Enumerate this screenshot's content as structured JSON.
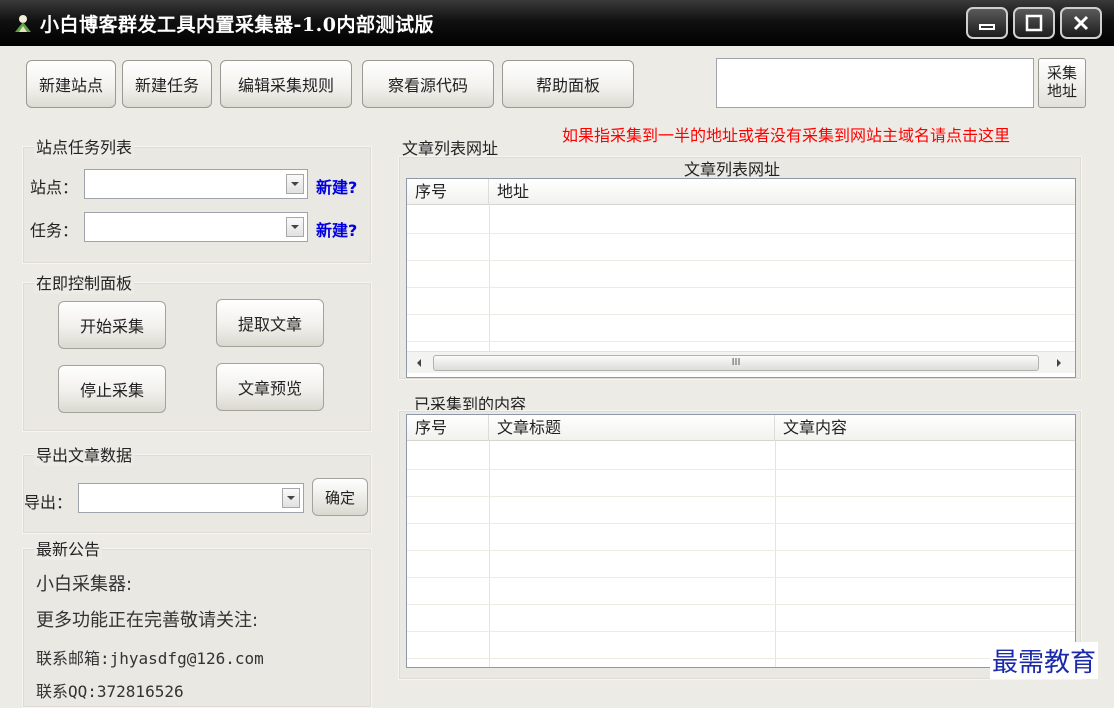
{
  "window": {
    "title": "小白博客群发工具内置采集器-1.0内部测试版"
  },
  "toolbar": {
    "buttons": [
      "新建站点",
      "新建任务",
      "编辑采集规则",
      "察看源代码",
      "帮助面板"
    ],
    "url_button": "采集\n地址",
    "url_value": "",
    "note": "如果指采集到一半的地址或者没有采集到网站主域名请点击这里"
  },
  "site_task": {
    "title": "站点任务列表",
    "site_label": "站点：",
    "task_label": "任务：",
    "site_value": "",
    "task_value": "",
    "new_link": "新建?"
  },
  "control": {
    "title": "在即控制面板",
    "start": "开始采集",
    "extract": "提取文章",
    "stop": "停止采集",
    "preview": "文章预览"
  },
  "export": {
    "title": "导出文章数据",
    "label": "导出：",
    "value": "",
    "ok": "确定"
  },
  "notice": {
    "title": "最新公告",
    "lines": [
      "小白采集器:",
      "更多功能正在完善敬请关注:",
      "联系邮箱:jhyasdfg@126.com",
      "联系QQ:372816526"
    ]
  },
  "article_list": {
    "group_label": "文章列表网址",
    "list_title": "文章列表网址",
    "columns": [
      "序号",
      "地址"
    ],
    "rows": [],
    "scroll_mark": "III"
  },
  "collected": {
    "group_label": "已采集到的内容",
    "columns": [
      "序号",
      "文章标题",
      "文章内容"
    ],
    "rows": []
  },
  "watermark": "最需教育",
  "icons": {
    "app": "app-logo-icon",
    "minimize": "minimize-icon",
    "maximize": "maximize-icon",
    "close": "close-icon",
    "dropdown": "chevron-down-icon"
  }
}
